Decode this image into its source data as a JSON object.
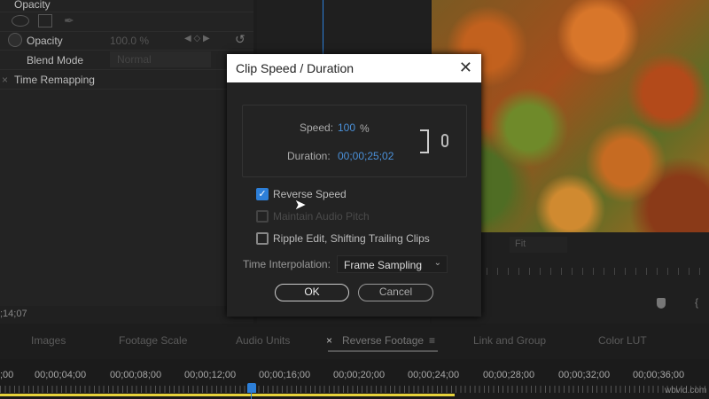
{
  "effects": {
    "section_title": "Opacity",
    "opacity_label": "Opacity",
    "opacity_value": "100.0 %",
    "blend_label": "Blend Mode",
    "blend_value": "Normal",
    "time_remap": "Time Remapping",
    "timecode": ";14;07"
  },
  "program": {
    "fit": "Fit"
  },
  "dialog": {
    "title": "Clip Speed / Duration",
    "speed_label": "Speed:",
    "speed_value": "100",
    "speed_unit": "%",
    "duration_label": "Duration:",
    "duration_value": "00;00;25;02",
    "reverse": "Reverse Speed",
    "reverse_checked": true,
    "maintain": "Maintain Audio Pitch",
    "maintain_checked": false,
    "ripple": "Ripple Edit, Shifting Trailing Clips",
    "ripple_checked": false,
    "interp_label": "Time Interpolation:",
    "interp_value": "Frame Sampling",
    "ok": "OK",
    "cancel": "Cancel"
  },
  "tabs": [
    "Images",
    "Footage Scale",
    "Audio Units",
    "Reverse Footage",
    "Link and Group",
    "Color LUT"
  ],
  "timecodes": [
    ";00",
    "00;00;04;00",
    "00;00;08;00",
    "00;00;12;00",
    "00;00;16;00",
    "00;00;20;00",
    "00;00;24;00",
    "00;00;28;00",
    "00;00;32;00",
    "00;00;36;00"
  ],
  "watermark": "wbvid.com",
  "colors": {
    "accent": "#2d7fd8",
    "work_area": "#e6d23a"
  }
}
